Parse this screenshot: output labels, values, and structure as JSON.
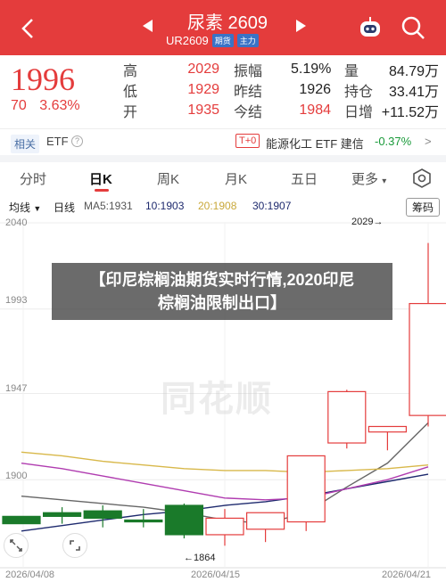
{
  "header": {
    "title": "尿素 2609",
    "code": "UR2609",
    "tag1": "期货",
    "tag2": "主力"
  },
  "quote": {
    "price": "1996",
    "change": "70",
    "change_pct": "3.63%",
    "rows": [
      {
        "l1": "高",
        "v1": "2029",
        "l2": "振幅",
        "v2": "5.19%",
        "l3": "量",
        "v3": "84.79万"
      },
      {
        "l1": "低",
        "v1": "1929",
        "l2": "昨结",
        "v2": "1926",
        "l3": "持仓",
        "v3": "33.41万"
      },
      {
        "l1": "开",
        "v1": "1935",
        "l2": "今结",
        "v2": "1984",
        "l3": "日增",
        "v3": "+11.52万"
      }
    ]
  },
  "related": {
    "tag": "相关",
    "etf": "ETF",
    "t0": "T+0",
    "name": "能源化工 ETF 建信",
    "pct": "-0.37%"
  },
  "tabs": [
    "分时",
    "日K",
    "周K",
    "月K",
    "五日",
    "更多"
  ],
  "indicators": {
    "line": "均线",
    "day": "日线",
    "ma5": "MA5:1931",
    "ma10": "10:1903",
    "ma20": "20:1908",
    "ma30": "30:1907",
    "chip": "筹码"
  },
  "overlay": {
    "line1": "【印尼棕榈油期货实时行情,2020印尼",
    "line2": "棕榈油限制出口】"
  },
  "watermark": "同花顺",
  "colors": {
    "up": "#e43c3c",
    "down": "#1a7a2a",
    "ma5": "#666666",
    "ma10": "#1e2a6e",
    "ma20": "#d8b84a",
    "ma30": "#b03cb0"
  },
  "chart_data": {
    "type": "candlestick",
    "ylim": [
      1852,
      2040
    ],
    "ytick_labels": [
      "2040",
      "1993",
      "1947",
      "1900"
    ],
    "xtick_labels": [
      "2026/04/08",
      "2026/04/15",
      "2026/04/21"
    ],
    "annotations": {
      "high": "2029→",
      "low": "←1864"
    },
    "candles": [
      {
        "open": 1880,
        "close": 1876,
        "high": 1880,
        "low": 1876
      },
      {
        "open": 1882,
        "close": 1880,
        "high": 1885,
        "low": 1876
      },
      {
        "open": 1883,
        "close": 1879,
        "high": 1886,
        "low": 1874
      },
      {
        "open": 1878,
        "close": 1877,
        "high": 1884,
        "low": 1874
      },
      {
        "open": 1886,
        "close": 1870,
        "high": 1887,
        "low": 1868
      },
      {
        "open": 1870,
        "close": 1879,
        "high": 1884,
        "low": 1864
      },
      {
        "open": 1873,
        "close": 1882,
        "high": 1882,
        "low": 1866
      },
      {
        "open": 1877,
        "close": 1913,
        "high": 1913,
        "low": 1872
      },
      {
        "open": 1920,
        "close": 1948,
        "high": 1949,
        "low": 1917
      },
      {
        "open": 1926,
        "close": 1929,
        "high": 1929,
        "low": 1916
      },
      {
        "open": 1935,
        "close": 1996,
        "high": 2029,
        "low": 1929
      }
    ],
    "ma_lines": [
      {
        "name": "MA5",
        "values": [
          1891,
          1889,
          1887,
          1885,
          1882,
          1878,
          1876,
          1882,
          1896,
          1909,
          1931
        ]
      },
      {
        "name": "10",
        "values": [
          1872,
          1875,
          1878,
          1881,
          1883,
          1886,
          1888,
          1891,
          1895,
          1899,
          1903
        ]
      },
      {
        "name": "20",
        "values": [
          1915,
          1913,
          1910,
          1908,
          1906,
          1905,
          1905,
          1904,
          1905,
          1906,
          1908
        ]
      },
      {
        "name": "30",
        "values": [
          1909,
          1906,
          1902,
          1898,
          1894,
          1890,
          1889,
          1890,
          1895,
          1900,
          1907
        ]
      }
    ]
  }
}
